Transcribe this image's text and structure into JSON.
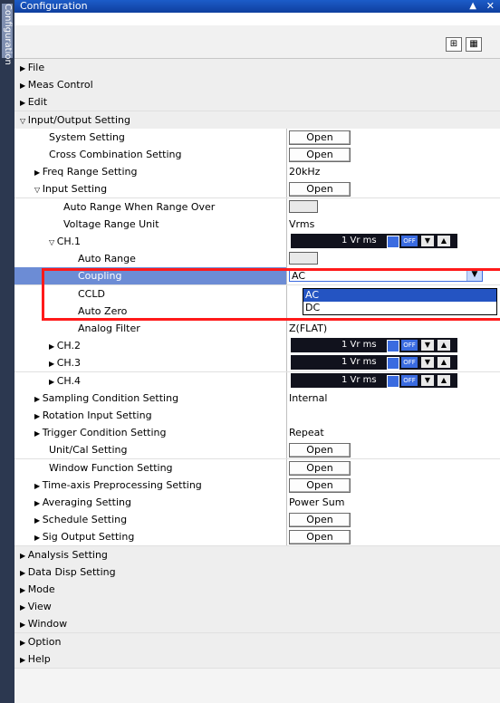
{
  "sidetab": {
    "label": "Configuration"
  },
  "window": {
    "title": "Configuration",
    "pin_icon": "pin-icon",
    "close_icon": "close-icon"
  },
  "toolbar": {
    "btn1_icon": "grid-icon",
    "btn2_icon": "panel-icon"
  },
  "tree": [
    {
      "label": "File",
      "indent": 0,
      "expand": "right",
      "type": "top"
    },
    {
      "label": "Meas Control",
      "indent": 0,
      "expand": "right",
      "type": "top"
    },
    {
      "label": "Edit",
      "indent": 0,
      "expand": "right",
      "type": "top"
    },
    {
      "label": "Input/Output Setting",
      "indent": 0,
      "expand": "down",
      "type": "top"
    },
    {
      "label": "System Setting",
      "indent": 2,
      "val": {
        "kind": "button",
        "text": "Open"
      }
    },
    {
      "label": "Cross Combination Setting",
      "indent": 2,
      "val": {
        "kind": "button",
        "text": "Open"
      }
    },
    {
      "label": "Freq Range Setting",
      "indent": 1,
      "expand": "right",
      "val": {
        "kind": "text",
        "text": "20kHz"
      }
    },
    {
      "label": "Input Setting",
      "indent": 1,
      "expand": "down",
      "val": {
        "kind": "button",
        "text": "Open"
      }
    },
    {
      "label": "Auto Range When Range Over",
      "indent": 3,
      "val": {
        "kind": "toggle"
      }
    },
    {
      "label": "Voltage Range Unit",
      "indent": 3,
      "val": {
        "kind": "text",
        "text": "Vrms"
      }
    },
    {
      "label": "CH.1",
      "indent": 2,
      "expand": "down",
      "val": {
        "kind": "range",
        "text": "1 Vr ms",
        "off": "OFF"
      }
    },
    {
      "label": "Auto Range",
      "indent": 4,
      "val": {
        "kind": "toggle"
      }
    },
    {
      "label": "Coupling",
      "indent": 4,
      "selected": true,
      "val": {
        "kind": "select",
        "text": "AC"
      }
    },
    {
      "label": "CCLD",
      "indent": 4,
      "val": {
        "kind": "text",
        "text": ""
      }
    },
    {
      "label": "Auto Zero",
      "indent": 4,
      "val": {
        "kind": "text",
        "text": ""
      }
    },
    {
      "label": "Analog Filter",
      "indent": 4,
      "val": {
        "kind": "text",
        "text": "Z(FLAT)"
      }
    },
    {
      "label": "CH.2",
      "indent": 2,
      "expand": "right",
      "val": {
        "kind": "range",
        "text": "1 Vr ms",
        "off": "OFF"
      }
    },
    {
      "label": "CH.3",
      "indent": 2,
      "expand": "right",
      "val": {
        "kind": "range",
        "text": "1 Vr ms",
        "off": "OFF"
      }
    },
    {
      "label": "CH.4",
      "indent": 2,
      "expand": "right",
      "val": {
        "kind": "range",
        "text": "1 Vr ms",
        "off": "OFF"
      }
    },
    {
      "label": "Sampling Condition Setting",
      "indent": 1,
      "expand": "right",
      "val": {
        "kind": "text",
        "text": "Internal"
      }
    },
    {
      "label": "Rotation Input Setting",
      "indent": 1,
      "expand": "right",
      "val": {
        "kind": "text",
        "text": ""
      }
    },
    {
      "label": "Trigger Condition Setting",
      "indent": 1,
      "expand": "right",
      "val": {
        "kind": "text",
        "text": "Repeat"
      }
    },
    {
      "label": "Unit/Cal Setting",
      "indent": 2,
      "val": {
        "kind": "button",
        "text": "Open"
      }
    },
    {
      "label": "Window Function Setting",
      "indent": 2,
      "val": {
        "kind": "button",
        "text": "Open"
      }
    },
    {
      "label": "Time-axis Preprocessing Setting",
      "indent": 1,
      "expand": "right",
      "val": {
        "kind": "button",
        "text": "Open"
      }
    },
    {
      "label": "Averaging Setting",
      "indent": 1,
      "expand": "right",
      "val": {
        "kind": "text",
        "text": "Power Sum"
      }
    },
    {
      "label": "Schedule Setting",
      "indent": 1,
      "expand": "right",
      "val": {
        "kind": "button",
        "text": "Open"
      }
    },
    {
      "label": "Sig Output Setting",
      "indent": 1,
      "expand": "right",
      "val": {
        "kind": "button",
        "text": "Open"
      }
    },
    {
      "label": "Analysis Setting",
      "indent": 0,
      "expand": "right",
      "type": "top"
    },
    {
      "label": "Data Disp Setting",
      "indent": 0,
      "expand": "right",
      "type": "top"
    },
    {
      "label": "Mode",
      "indent": 0,
      "expand": "right",
      "type": "top"
    },
    {
      "label": "View",
      "indent": 0,
      "expand": "right",
      "type": "top"
    },
    {
      "label": "Window",
      "indent": 0,
      "expand": "right",
      "type": "top"
    },
    {
      "label": "Option",
      "indent": 0,
      "expand": "right",
      "type": "top"
    },
    {
      "label": "Help",
      "indent": 0,
      "expand": "right",
      "type": "top"
    }
  ],
  "dropdown": {
    "options": [
      "AC",
      "DC"
    ],
    "highlight": "AC"
  },
  "colors": {
    "title": "#1c5cc8",
    "selected_row": "#6c8cd5",
    "highlight_box": "#ff1a1a"
  }
}
